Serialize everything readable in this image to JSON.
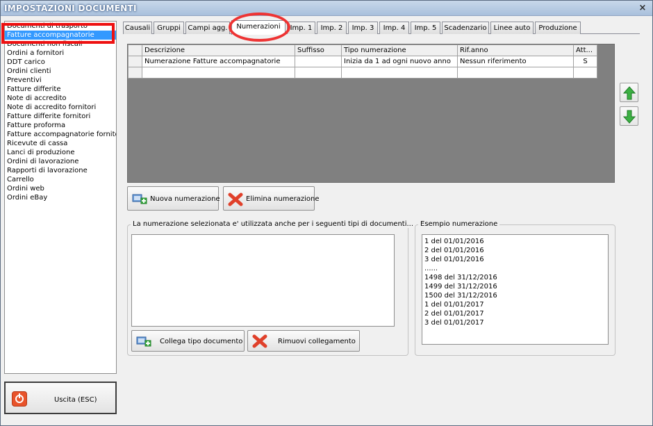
{
  "window": {
    "title": "IMPOSTAZIONI DOCUMENTI",
    "close_glyph": "×"
  },
  "doc_types": [
    "Documenti di trasporto",
    "Fatture accompagnatorie",
    "Documenti non fiscali",
    "Ordini a fornitori",
    "DDT carico",
    "Ordini clienti",
    "Preventivi",
    "Fatture differite",
    "Note di accredito",
    "Note di accredito fornitori",
    "Fatture differite fornitori",
    "Fatture proforma",
    "Fatture accompagnatorie fornito",
    "Ricevute di cassa",
    "Lanci di produzione",
    "Ordini di lavorazione",
    "Rapporti di lavorazione",
    "Carrello",
    "Ordini web",
    "Ordini eBay"
  ],
  "selected_doc_type": "Fatture accompagnatorie",
  "exit_button": {
    "label": "Uscita (ESC)",
    "icon": "power-icon"
  },
  "tabs": [
    "Causali",
    "Gruppi",
    "Campi agg.",
    "Numerazioni",
    "Imp. 1",
    "Imp. 2",
    "Imp. 3",
    "Imp. 4",
    "Imp. 5",
    "Scadenzario",
    "Linee auto",
    "Produzione"
  ],
  "active_tab": "Numerazioni",
  "grid": {
    "columns": [
      "Descrizione",
      "Suffisso",
      "Tipo numerazione",
      "Rif.anno",
      "Att..."
    ],
    "rows": [
      [
        "Numerazione Fatture accompagnatorie",
        "",
        "Inizia da 1 ad ogni nuovo anno",
        "Nessun riferimento",
        "S"
      ],
      [
        "",
        "",
        "",
        "",
        ""
      ]
    ]
  },
  "buttons": {
    "new_numbering": "Nuova numerazione",
    "delete_numbering": "Elimina numerazione",
    "link_doc_type": "Collega tipo documento",
    "remove_link": "Rimuovi collegamento"
  },
  "linked_group": {
    "legend": "La numerazione selezionata e' utilizzata anche per i seguenti tipi di documenti..."
  },
  "example_group": {
    "legend": "Esempio numerazione",
    "lines": [
      "1 del 01/01/2016",
      "2 del 01/01/2016",
      "3 del 01/01/2016",
      "......",
      "1498 del 31/12/2016",
      "1499 del 31/12/2016",
      "1500 del 31/12/2016",
      "1 del 01/01/2017",
      "2 del 01/01/2017",
      "3 del 01/01/2017"
    ]
  },
  "colors": {
    "selection": "#3399ff",
    "highlight": "#ee1111",
    "arrow_green": "#3cb043",
    "grid_bg": "#808080"
  }
}
